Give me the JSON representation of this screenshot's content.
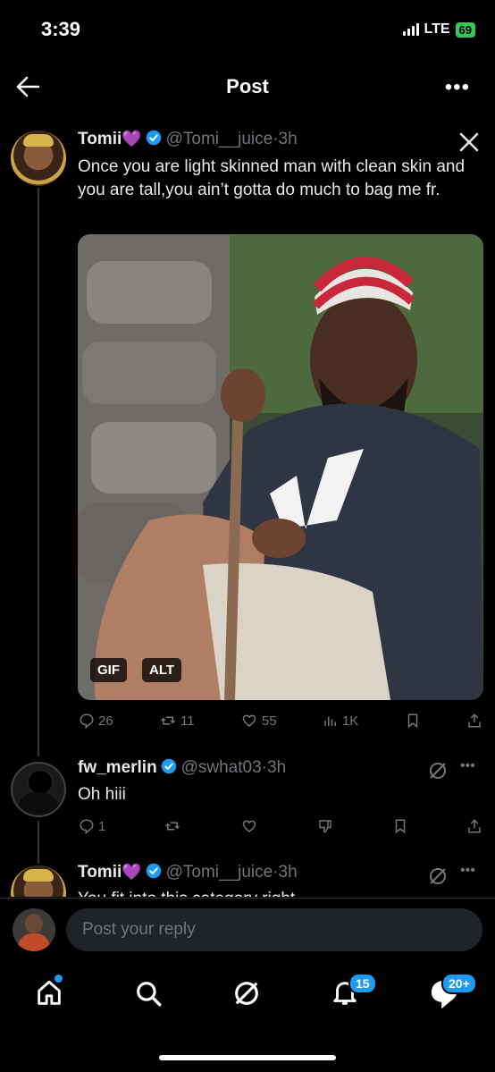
{
  "status": {
    "time": "3:39",
    "network": "LTE",
    "battery": "69"
  },
  "header": {
    "title": "Post"
  },
  "main_post": {
    "name": "Tomii",
    "emoji": "💜",
    "handle": "@Tomi__juice",
    "time": "3h",
    "text": "Once you are light skinned man with clean skin and you are tall,you ain’t gotta do much to bag me fr.",
    "media_badges": {
      "gif": "GIF",
      "alt": "ALT"
    },
    "stats": {
      "replies": "26",
      "reposts": "11",
      "likes": "55",
      "views": "1K"
    }
  },
  "reply1": {
    "name": "fw_merlin",
    "handle": "@swhat03",
    "time": "3h",
    "text": "Oh hiii",
    "stats": {
      "replies": "1"
    }
  },
  "reply2": {
    "name": "Tomii",
    "emoji": "💜",
    "handle": "@Tomi__juice",
    "time": "3h",
    "text": "You fit into this category right"
  },
  "composer": {
    "placeholder": "Post your reply"
  },
  "tabbar": {
    "notifications_count": "15",
    "messages_count": "20+"
  },
  "colors": {
    "accent": "#1d9bf0",
    "background": "#000000",
    "muted": "#71767b",
    "verified": "#1d9bf0"
  },
  "icons": [
    "back-arrow-icon",
    "more-icon",
    "x-logo-icon",
    "verified-icon",
    "reply-icon",
    "repost-icon",
    "like-icon",
    "views-icon",
    "bookmark-icon",
    "share-icon",
    "grok-icon",
    "dislike-icon",
    "home-icon",
    "search-icon",
    "bell-icon",
    "messages-icon"
  ]
}
